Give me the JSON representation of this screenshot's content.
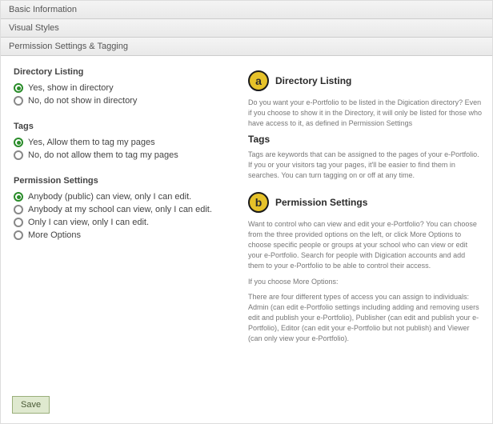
{
  "accordion": {
    "basic_info": "Basic Information",
    "visual_styles": "Visual Styles",
    "perm_tagging": "Permission Settings & Tagging"
  },
  "left": {
    "directory": {
      "title": "Directory Listing",
      "opt_yes": "Yes, show in directory",
      "opt_no": "No, do not show in directory"
    },
    "tags": {
      "title": "Tags",
      "opt_yes": "Yes, Allow them to tag my pages",
      "opt_no": "No, do not allow them to tag my pages"
    },
    "perm": {
      "title": "Permission Settings",
      "opt_public": "Anybody (public) can view, only I can edit.",
      "opt_school": "Anybody at my school can view, only I can edit.",
      "opt_onlyme": "Only I can view, only I can edit.",
      "opt_more": "More Options"
    }
  },
  "right": {
    "a": {
      "badge": "a",
      "title": "Directory Listing",
      "body": "Do you want your e-Portfolio to be listed in the Digication directory? Even if you choose to show it in the Directory, it will only be listed for those who have access to it, as defined in Permission Settings",
      "tags_title": "Tags",
      "tags_body": "Tags are keywords that can be assigned to the pages of your e-Portfolio. If you or your visitors tag your pages, it'll be easier to find them in searches. You can turn tagging on or off at any time."
    },
    "b": {
      "badge": "b",
      "title": "Permission Settings",
      "body1": "Want to control who can view and edit your e-Portfolio? You can choose from the three provided options on the left, or click More Options to choose specific people or groups at your school who can view or edit your e-Portfolio. Search for people with Digication accounts and add them to your e-Portfolio to be able to control their access.",
      "body2_intro": "If you choose More Options:",
      "body2": "There are four different types of access you can assign to individuals: Admin (can edit e-Portfolio settings including adding and removing users edit and publish your e-Portfolio), Publisher (can edit and publish your e-Portfolio), Editor (can edit your e-Portfolio but not publish) and Viewer (can only view your e-Portfolio)."
    }
  },
  "save": "Save"
}
